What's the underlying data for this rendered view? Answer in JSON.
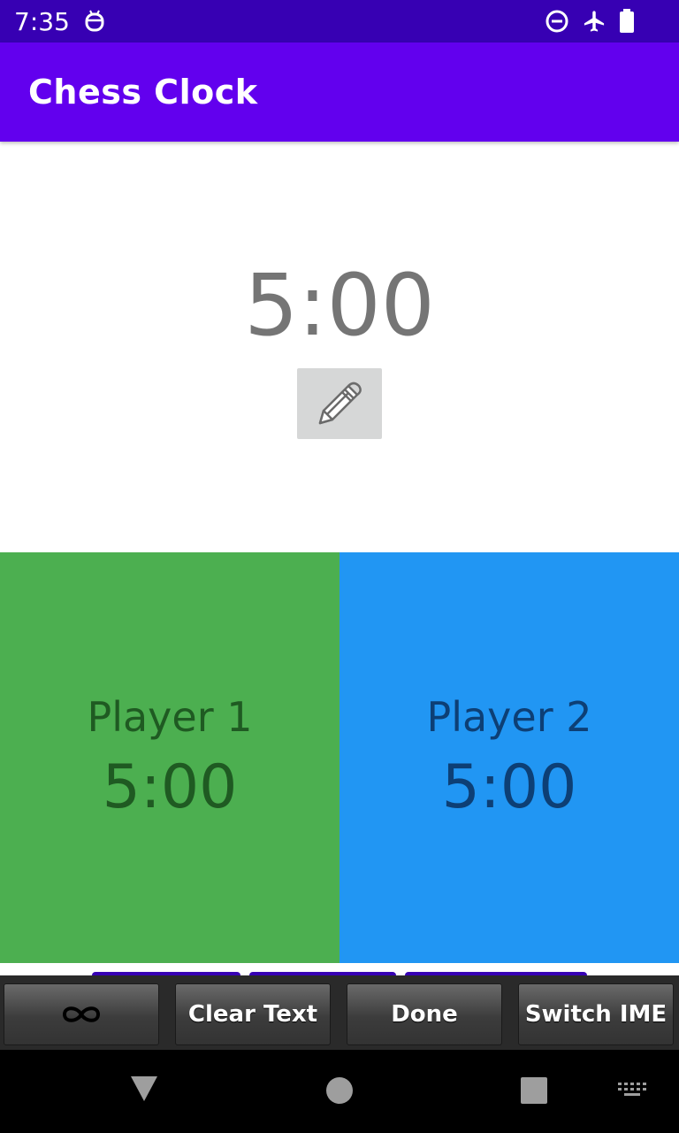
{
  "status_bar": {
    "time": "7:35",
    "icons": [
      "android-debug-icon",
      "do-not-disturb-icon",
      "airplane-mode-icon",
      "battery-icon"
    ],
    "background": "#3700b3"
  },
  "app_bar": {
    "title": "Chess Clock",
    "background": "#6200ee"
  },
  "main_clock": {
    "time": "5:00",
    "edit_icon": "pencil-icon"
  },
  "players": [
    {
      "name": "Player 1",
      "time": "5:00",
      "color": "#4caf50"
    },
    {
      "name": "Player 2",
      "time": "5:00",
      "color": "#2196f3"
    }
  ],
  "ime_bar": {
    "keys": [
      {
        "icon": "infinity-icon"
      },
      {
        "label": "Clear Text"
      },
      {
        "label": "Done"
      },
      {
        "label": "Switch IME"
      }
    ]
  },
  "nav_bar": {
    "icons": [
      "back-icon",
      "home-icon",
      "recents-icon",
      "keyboard-icon"
    ]
  }
}
